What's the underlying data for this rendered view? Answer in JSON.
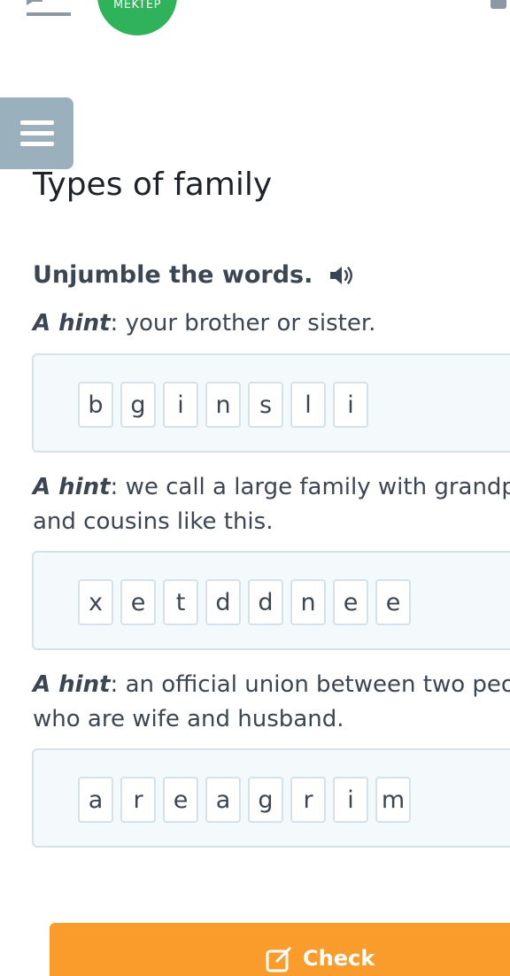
{
  "header": {
    "logo_text": "MEKTEP",
    "menu_icon": "hamburger-menu-icon"
  },
  "page": {
    "title": "Types of family"
  },
  "exercise": {
    "instruction": "Unjumble the words.",
    "audio_icon": "speaker-icon",
    "items": [
      {
        "hint_label": "A hint",
        "hint_line1": ": your brother or sister.",
        "hint_line2": "",
        "letters": [
          "b",
          "g",
          "i",
          "n",
          "s",
          "l",
          "i"
        ]
      },
      {
        "hint_label": "A hint",
        "hint_line1": ": we call a large family with grandp",
        "hint_line2": "and cousins like this.",
        "letters": [
          "x",
          "e",
          "t",
          "d",
          "d",
          "n",
          "e",
          "e"
        ]
      },
      {
        "hint_label": "A hint",
        "hint_line1": ": an official union between two peo",
        "hint_line2": "who are wife and husband.",
        "letters": [
          "a",
          "r",
          "e",
          "a",
          "g",
          "r",
          "i",
          "m"
        ]
      }
    ]
  },
  "footer": {
    "check_label": "Check",
    "check_color": "#f99c2c"
  },
  "colors": {
    "accent_green": "#2fb35a",
    "menu_bg": "#9ab0bd",
    "tile_border": "#d4e2ea",
    "text": "#3b4653"
  }
}
